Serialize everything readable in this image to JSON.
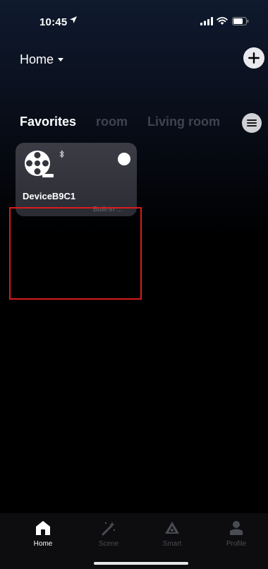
{
  "status_bar": {
    "time": "10:45"
  },
  "header": {
    "home_label": "Home"
  },
  "tabs": [
    {
      "label": "Favorites",
      "active": true
    },
    {
      "label": "room",
      "active": false
    },
    {
      "label": "Living room",
      "active": false
    }
  ],
  "device": {
    "name": "DeviceB9C1",
    "subtitle": "Built-in ...",
    "power_on": true
  },
  "bottom_nav": [
    {
      "label": "Home",
      "icon": "home-icon",
      "active": true
    },
    {
      "label": "Scene",
      "icon": "scene-wand-icon",
      "active": false
    },
    {
      "label": "Smart",
      "icon": "smart-icon",
      "active": false
    },
    {
      "label": "Profile",
      "icon": "profile-icon",
      "active": false
    }
  ],
  "colors": {
    "active_text": "#ffffff",
    "inactive_tab": "#3d4350",
    "highlight_box": "#d91b1b",
    "card_bg": "#33343c"
  }
}
